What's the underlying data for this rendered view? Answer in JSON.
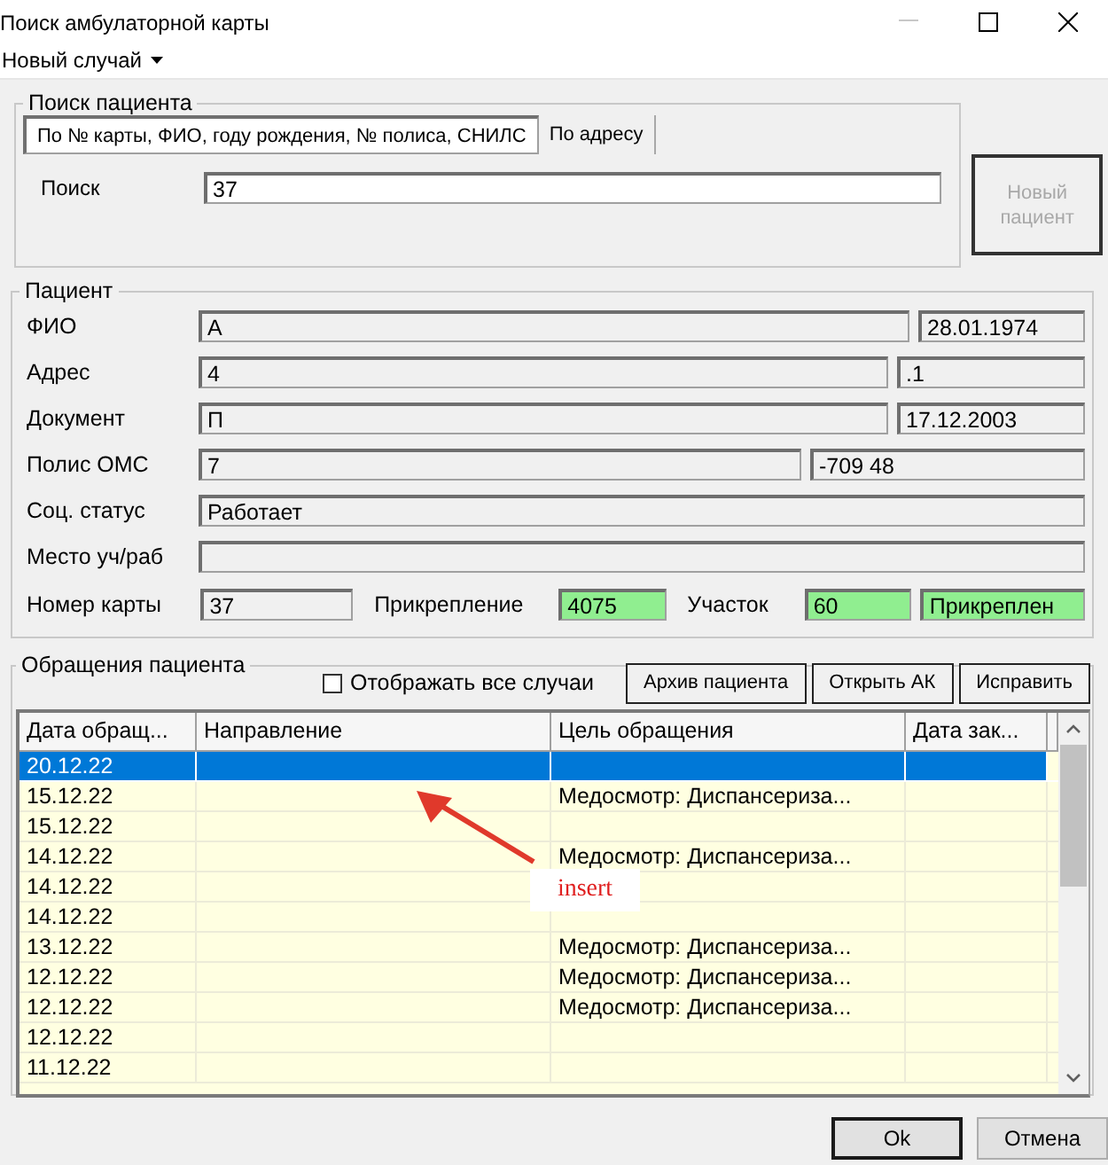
{
  "window": {
    "title": "Поиск амбулаторной карты"
  },
  "menu": [
    {
      "label": "Новый случай"
    }
  ],
  "search": {
    "title": "Поиск пациента",
    "tabs": [
      {
        "label": "По № карты, ФИО, году рождения, № полиса, СНИЛС",
        "selected": true
      },
      {
        "label": "По адресу",
        "selected": false
      }
    ],
    "label": "Поиск",
    "value": "37"
  },
  "new_patient_button": {
    "label": "Новый пациент",
    "disabled": true
  },
  "patient": {
    "title": "Пациент",
    "rows": [
      {
        "label": "ФИО",
        "fields": [
          {
            "value": "А"
          },
          {
            "value": "28.01.1974"
          }
        ]
      },
      {
        "label": "Адрес",
        "fields": [
          {
            "value": "4"
          },
          {
            "value": ".1"
          }
        ]
      },
      {
        "label": "Документ",
        "fields": [
          {
            "value": "П"
          },
          {
            "value": "17.12.2003"
          }
        ]
      },
      {
        "label": "Полис ОМС",
        "fields": [
          {
            "value": "7"
          },
          {
            "value": "-709 48"
          }
        ]
      },
      {
        "label": "Соц. статус",
        "fields": [
          {
            "value": "Работает"
          }
        ]
      },
      {
        "label": "Место уч/раб"
      }
    ],
    "card_row": [
      {
        "kind": "label",
        "text": "Номер карты"
      },
      {
        "kind": "field",
        "value": "37",
        "highlighted": false
      },
      {
        "kind": "label",
        "text": "Прикрепление"
      },
      {
        "kind": "field",
        "value": "4075",
        "highlighted": true
      },
      {
        "kind": "label",
        "text": "Участок"
      },
      {
        "kind": "field",
        "value": "60",
        "highlighted": true
      },
      {
        "kind": "field",
        "value": "Прикреплен",
        "highlighted": true
      }
    ]
  },
  "visits": {
    "title": "Обращения пациента",
    "show_all": {
      "label": "Отображать все случаи",
      "checked": false
    },
    "buttons": [
      "Архив пациента",
      "Открыть АК",
      "Исправить"
    ],
    "columns": [
      "Дата обращ...",
      "Направление",
      "Цель обращения",
      "Дата зак..."
    ],
    "rows": [
      {
        "date": "20.12.22",
        "selected": true
      },
      {
        "date": "15.12.22",
        "goal": "Медосмотр: Диспансериза...",
        "selected": false
      },
      {
        "date": "15.12.22",
        "selected": false
      },
      {
        "date": "14.12.22",
        "goal": "Медосмотр: Диспансериза...",
        "selected": false
      },
      {
        "date": "14.12.22",
        "selected": false
      },
      {
        "date": "14.12.22",
        "selected": false
      },
      {
        "date": "13.12.22",
        "goal": "Медосмотр: Диспансериза...",
        "selected": false
      },
      {
        "date": "12.12.22",
        "goal": "Медосмотр: Диспансериза...",
        "selected": false
      },
      {
        "date": "12.12.22",
        "goal": "Медосмотр: Диспансериза...",
        "selected": false
      },
      {
        "date": "12.12.22",
        "selected": false
      },
      {
        "date": "11.12.22",
        "selected": false
      }
    ],
    "annotation": {
      "text": "insert"
    }
  },
  "footer_buttons": [
    "Ok",
    "Отмена"
  ]
}
